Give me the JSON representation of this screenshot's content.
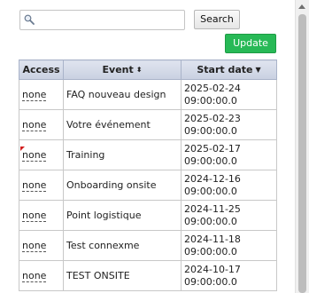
{
  "search": {
    "placeholder": "",
    "value": "",
    "button_label": "Search"
  },
  "actions": {
    "update_label": "Update"
  },
  "table": {
    "headers": {
      "access": "Access",
      "event": "Event",
      "start_date": "Start date"
    },
    "sort_icons": {
      "event": "⬍",
      "start_date": "▼"
    },
    "rows": [
      {
        "access": "none",
        "event": "FAQ nouveau design",
        "date": "2025-02-24",
        "time": "09:00:00.0",
        "flag": false
      },
      {
        "access": "none",
        "event": "Votre événement",
        "date": "2025-02-23",
        "time": "09:00:00.0",
        "flag": false
      },
      {
        "access": "none",
        "event": "Training",
        "date": "2025-02-17",
        "time": "09:00:00.0",
        "flag": true
      },
      {
        "access": "none",
        "event": "Onboarding onsite",
        "date": "2024-12-16",
        "time": "09:00:00.0",
        "flag": false
      },
      {
        "access": "none",
        "event": "Point logistique",
        "date": "2024-11-25",
        "time": "09:00:00.0",
        "flag": false
      },
      {
        "access": "none",
        "event": "Test connexme",
        "date": "2024-11-18",
        "time": "09:00:00.0",
        "flag": false
      },
      {
        "access": "none",
        "event": "TEST ONSITE",
        "date": "2024-10-17",
        "time": "09:00:00.0",
        "flag": false
      }
    ]
  },
  "colors": {
    "update_button": "#27b956",
    "header_bg": "#d4dae8",
    "flag": "#d21f1f"
  }
}
